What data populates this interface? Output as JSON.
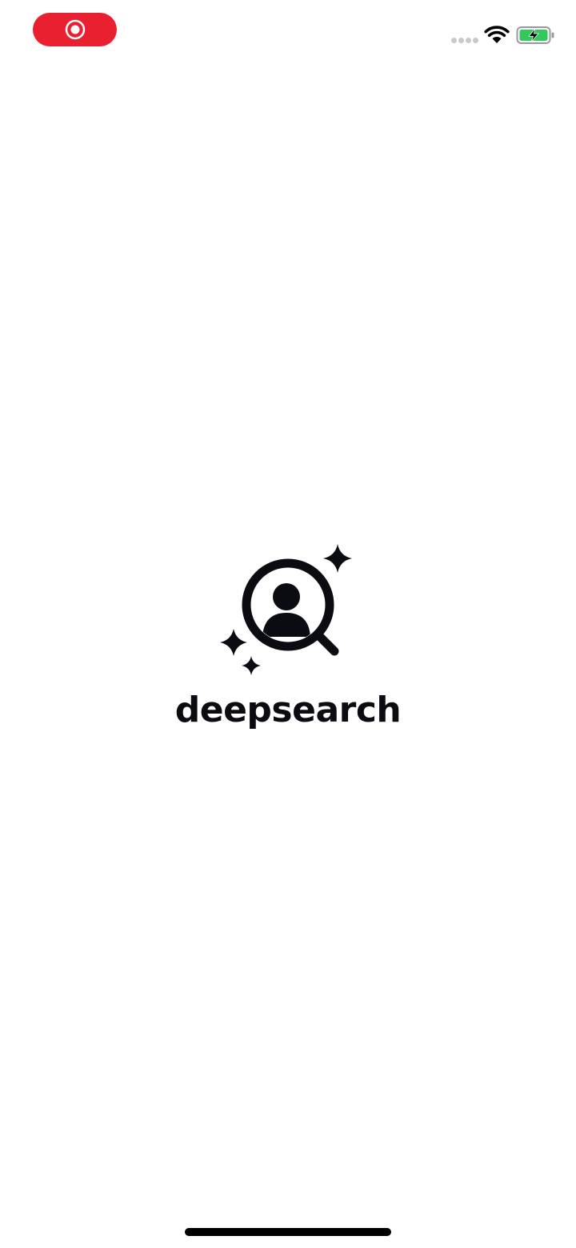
{
  "status_bar": {
    "recording_indicator": {
      "icon": "screen-record-icon",
      "color": "#e8202f"
    },
    "icons": [
      "cellular-signal-icon",
      "wifi-icon",
      "battery-charging-icon"
    ],
    "battery_color": "#34c759"
  },
  "splash": {
    "logo_icon": "person-search-sparkles-icon",
    "brand_name": "deepsearch",
    "text_color": "#0b0b12"
  },
  "home_indicator": {
    "color": "#000000"
  }
}
